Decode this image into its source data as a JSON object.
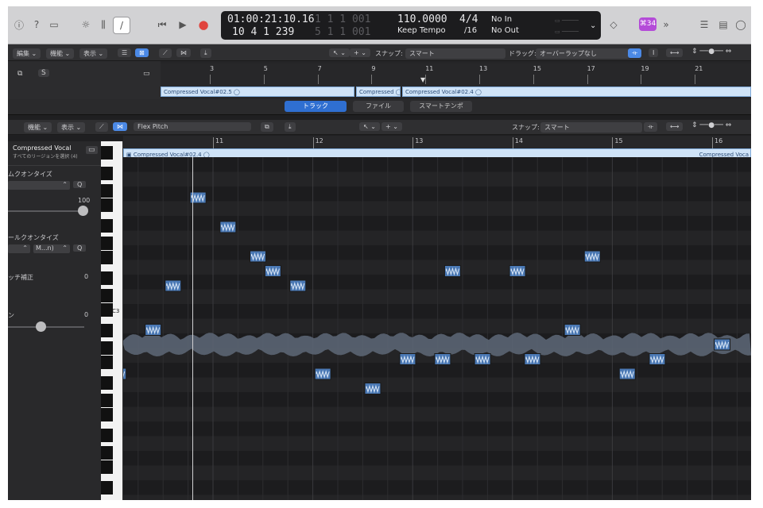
{
  "control_bar": {
    "position_time": "01:00:21:10.16",
    "position_bars": "10 4 1 239",
    "cycle_start_dim": "1 1 1 001",
    "cycle_end_dim": "5 1 1 001",
    "tempo": "110.0000",
    "tempo_mode": "Keep Tempo",
    "time_signature": "4/4",
    "division": "/16",
    "midi_in": "No In",
    "midi_out": "No Out",
    "badge": "⌘34",
    "more": "»"
  },
  "main_toolbar": {
    "menu_edit": "編集",
    "menu_function": "機能",
    "menu_view": "表示",
    "snap_label": "スナップ:",
    "snap_value": "スマート",
    "drag_label": "ドラッグ:",
    "drag_value": "オーバーラップなし",
    "header_s": "S"
  },
  "main_ruler": {
    "bars": [
      "3",
      "5",
      "7",
      "9",
      "11",
      "13",
      "15",
      "17",
      "19",
      "21"
    ]
  },
  "main_regions": [
    {
      "label": "Compressed Vocal#02.5"
    },
    {
      "label": "Compressed"
    },
    {
      "label": "Compressed Vocal#02.4"
    }
  ],
  "tabs": {
    "track": "トラック",
    "file": "ファイル",
    "smart_tempo": "スマートテンポ"
  },
  "editor_toolbar": {
    "menu_function": "機能",
    "menu_view": "表示",
    "mode": "Flex Pitch",
    "snap_label": "スナップ:",
    "snap_value": "スマート"
  },
  "editor_ruler": {
    "bars": [
      "11",
      "12",
      "13",
      "14",
      "15",
      "16"
    ]
  },
  "editor_region": {
    "label": "Compressed Vocal#02.4",
    "label_right": "Compressed Voca"
  },
  "inspector": {
    "track_name": "Compressed Vocal",
    "subtitle": "すべてのリージョンを選択 (4)",
    "quantize1_label": "ムクオンタイズ",
    "q_button": "Q",
    "strength_value": "100",
    "quantize2_label": "ールクオンタイズ",
    "scale_value": "M...n)",
    "correction_label": "ッチ補正",
    "correction_value": "0",
    "transpose_value": "0"
  },
  "piano": {
    "c3_label": "C3"
  },
  "chart_data": {
    "type": "piano-roll",
    "notes": [
      {
        "bar": 10.05,
        "pitch": -2
      },
      {
        "bar": 10.4,
        "pitch": 1
      },
      {
        "bar": 10.6,
        "pitch": 4
      },
      {
        "bar": 10.85,
        "pitch": 10
      },
      {
        "bar": 11.15,
        "pitch": 8
      },
      {
        "bar": 11.45,
        "pitch": 6
      },
      {
        "bar": 11.6,
        "pitch": 5
      },
      {
        "bar": 11.85,
        "pitch": 4
      },
      {
        "bar": 12.1,
        "pitch": -2
      },
      {
        "bar": 12.6,
        "pitch": -3
      },
      {
        "bar": 12.95,
        "pitch": -1
      },
      {
        "bar": 13.3,
        "pitch": -1
      },
      {
        "bar": 13.4,
        "pitch": 5
      },
      {
        "bar": 13.7,
        "pitch": -1
      },
      {
        "bar": 14.05,
        "pitch": 5
      },
      {
        "bar": 14.2,
        "pitch": -1
      },
      {
        "bar": 14.6,
        "pitch": 1
      },
      {
        "bar": 14.8,
        "pitch": 6
      },
      {
        "bar": 15.15,
        "pitch": -2
      },
      {
        "bar": 15.45,
        "pitch": -1
      },
      {
        "bar": 16.1,
        "pitch": 0
      }
    ]
  }
}
